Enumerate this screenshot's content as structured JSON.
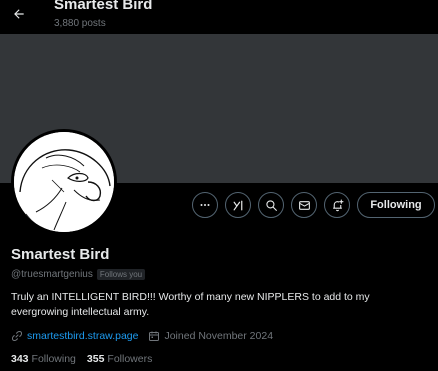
{
  "header": {
    "back_icon": "arrow-left-icon",
    "title": "Smartest Bird",
    "posts_count": "3,880 posts"
  },
  "profile": {
    "display_name": "Smartest Bird",
    "handle": "@truesmartgenius",
    "follows_you": "Follows you",
    "bio": "Truly an INTELLIGENT BIRD!!! Worthy of many new NIPPLERS to add to my evergrowing intellectual army.",
    "link": "smartestbird.straw.page",
    "joined": "Joined November 2024",
    "following_count": "343",
    "following_label": "Following",
    "followers_count": "355",
    "followers_label": "Followers"
  },
  "actions": {
    "more_icon": "more-icon",
    "grok_icon": "grok-icon",
    "search_icon": "search-icon",
    "message_icon": "envelope-icon",
    "notify_icon": "bell-plus-icon",
    "following_button": "Following"
  },
  "colors": {
    "background": "#000000",
    "banner": "#333639",
    "link": "#1d9bf0",
    "muted": "#71767b",
    "text": "#e7e9ea",
    "border": "#536471"
  }
}
